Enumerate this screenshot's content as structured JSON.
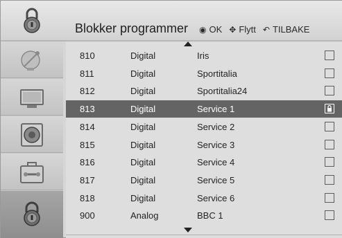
{
  "header": {
    "title": "Blokker programmer",
    "hints": [
      {
        "icon": "ok-icon",
        "glyph": "◉",
        "label": "OK"
      },
      {
        "icon": "move-icon",
        "glyph": "✥",
        "label": "Flytt"
      },
      {
        "icon": "back-icon",
        "glyph": "↶",
        "label": "TILBAKE"
      }
    ]
  },
  "sidebar": {
    "items": [
      {
        "name": "satellite-icon",
        "active": false
      },
      {
        "name": "tv-screen-icon",
        "active": false
      },
      {
        "name": "speaker-icon",
        "active": false
      },
      {
        "name": "toolbox-icon",
        "active": false
      },
      {
        "name": "lock-icon",
        "active": true
      }
    ]
  },
  "channels": [
    {
      "num": "810",
      "type": "Digital",
      "name": "Iris",
      "locked": false,
      "selected": false
    },
    {
      "num": "811",
      "type": "Digital",
      "name": "Sportitalia",
      "locked": false,
      "selected": false
    },
    {
      "num": "812",
      "type": "Digital",
      "name": "Sportitalia24",
      "locked": false,
      "selected": false
    },
    {
      "num": "813",
      "type": "Digital",
      "name": "Service 1",
      "locked": true,
      "selected": true
    },
    {
      "num": "814",
      "type": "Digital",
      "name": "Service 2",
      "locked": false,
      "selected": false
    },
    {
      "num": "815",
      "type": "Digital",
      "name": "Service 3",
      "locked": false,
      "selected": false
    },
    {
      "num": "816",
      "type": "Digital",
      "name": "Service 4",
      "locked": false,
      "selected": false
    },
    {
      "num": "817",
      "type": "Digital",
      "name": "Service 5",
      "locked": false,
      "selected": false
    },
    {
      "num": "818",
      "type": "Digital",
      "name": "Service 6",
      "locked": false,
      "selected": false
    },
    {
      "num": "900",
      "type": "Analog",
      "name": "BBC 1",
      "locked": false,
      "selected": false
    }
  ],
  "colors": {
    "selected_row": "#646464",
    "background": "#dedede"
  }
}
